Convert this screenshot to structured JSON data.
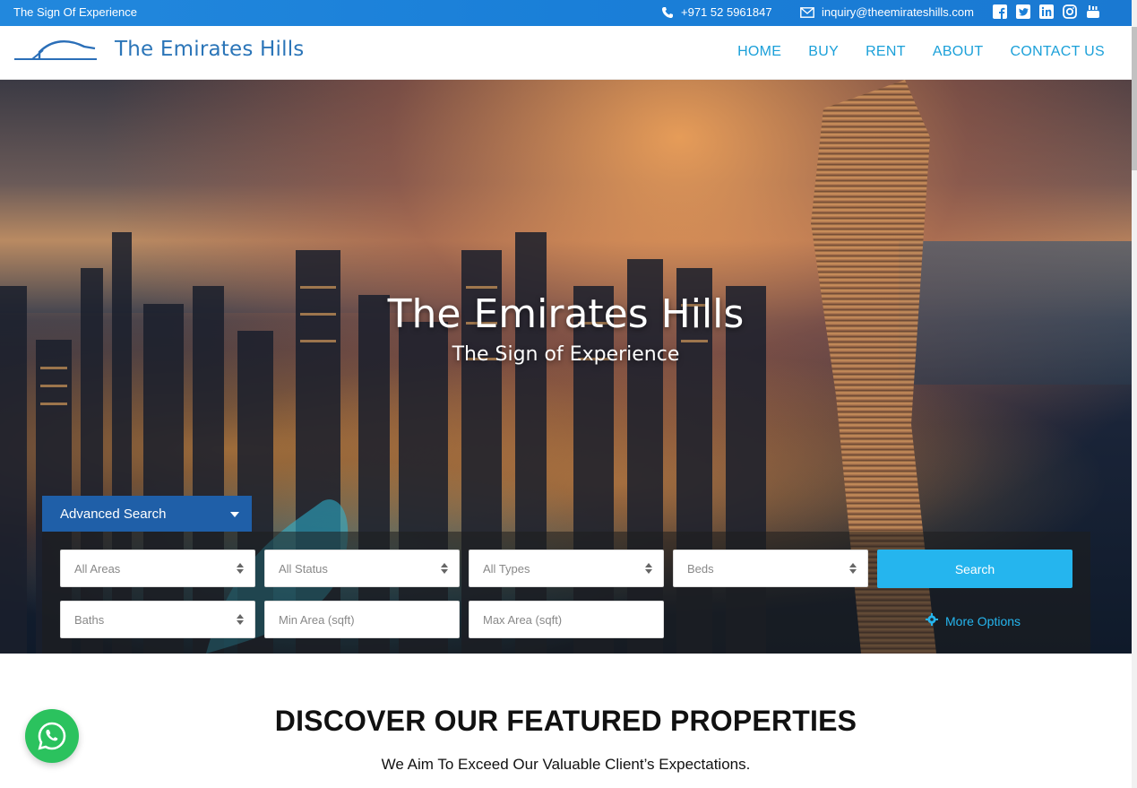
{
  "topbar": {
    "tagline": "The Sign Of Experience",
    "phone": "+971 52 5961847",
    "email": "inquiry@theemirateshills.com",
    "socials": [
      "facebook-icon",
      "twitter-icon",
      "linkedin-icon",
      "instagram-icon",
      "youtube-icon"
    ]
  },
  "header": {
    "logo_text": "The Emirates Hills",
    "nav": [
      "HOME",
      "BUY",
      "RENT",
      "ABOUT",
      "CONTACT US"
    ]
  },
  "hero": {
    "title": "The Emirates Hills",
    "subtitle": "The Sign of Experience"
  },
  "search": {
    "tab_label": "Advanced Search",
    "areas": "All Areas",
    "status": "All Status",
    "types": "All Types",
    "beds": "Beds",
    "baths": "Baths",
    "min_area": "Min Area (sqft)",
    "max_area": "Max Area (sqft)",
    "search_label": "Search",
    "more_options": "More Options"
  },
  "featured": {
    "title": "DISCOVER OUR FEATURED PROPERTIES",
    "subtitle": "We Aim To Exceed Our Valuable Client’s Expectations."
  },
  "colors": {
    "topbar": "#1a7fd8",
    "nav": "#1ba0d9",
    "search_button": "#25b5ee",
    "adv_tab": "#1f5fa8",
    "whatsapp": "#2bc25e"
  }
}
